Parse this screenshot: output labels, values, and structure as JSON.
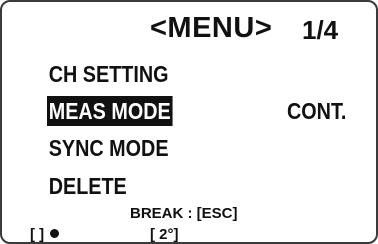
{
  "header": {
    "title": "<MENU>",
    "page_indicator": "1/4"
  },
  "menu": {
    "items": [
      {
        "label": "CH SETTING",
        "value": ""
      },
      {
        "label": "MEAS MODE",
        "value": "CONT.",
        "selected": true
      },
      {
        "label": "SYNC MODE",
        "value": ""
      },
      {
        "label": "DELETE",
        "value": ""
      }
    ]
  },
  "footer": {
    "hint": "BREAK : [ESC]",
    "status_left": "[      ]",
    "status_angle": "[ 2°]"
  },
  "colors": {
    "background": "#ffffff",
    "text": "#111111",
    "selection_background": "#111111",
    "selection_text": "#ffffff"
  }
}
